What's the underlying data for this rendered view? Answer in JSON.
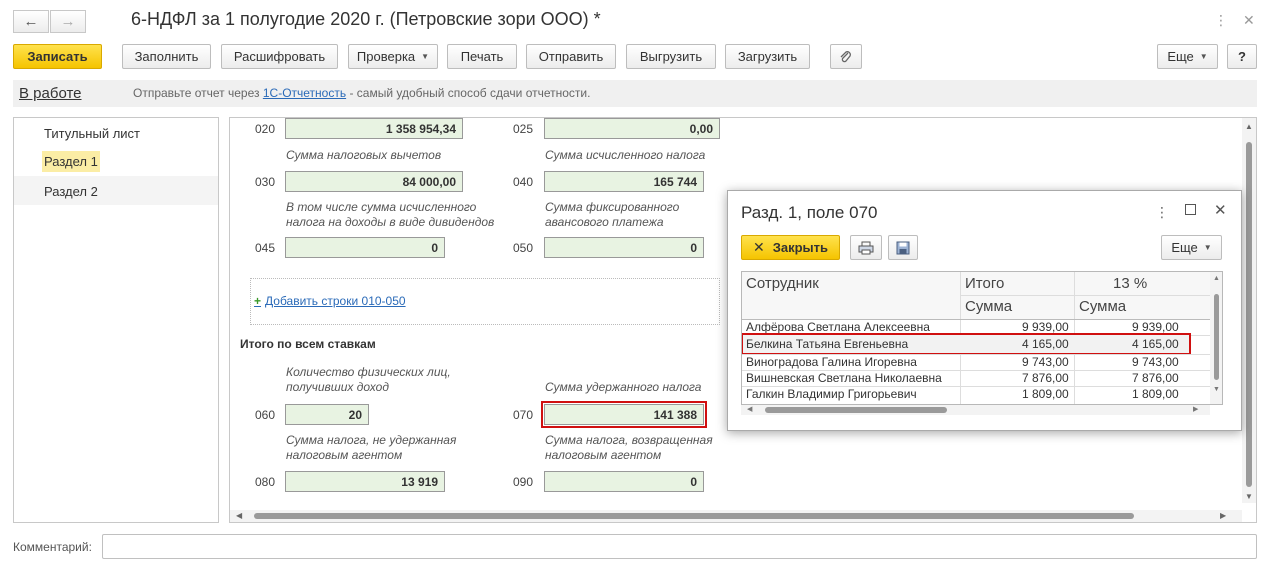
{
  "window": {
    "title": "6-НДФЛ за 1 полугодие 2020 г. (Петровские зори ООО) *",
    "back_icon": "arrow-left-icon",
    "forward_icon": "arrow-right-icon"
  },
  "toolbar": {
    "save": "Записать",
    "fill": "Заполнить",
    "decode": "Расшифровать",
    "check": "Проверка",
    "print": "Печать",
    "send": "Отправить",
    "export": "Выгрузить",
    "import": "Загрузить",
    "more": "Еще",
    "help": "?"
  },
  "status": {
    "state": "В работе",
    "hint_prefix": "Отправьте отчет через",
    "hint_link": "1С-Отчетность",
    "hint_suffix": "- самый удобный способ сдачи отчетности."
  },
  "sections": [
    {
      "label": "Титульный лист"
    },
    {
      "label": "Раздел 1"
    },
    {
      "label": "Раздел 2"
    }
  ],
  "form": {
    "f020": {
      "code": "020",
      "value": "1 358 954,34"
    },
    "f025": {
      "code": "025",
      "value": "0,00"
    },
    "f030": {
      "code": "030",
      "label": "Сумма налоговых вычетов",
      "value": "84 000,00"
    },
    "f040": {
      "code": "040",
      "label": "Сумма исчисленного налога",
      "value": "165 744"
    },
    "f045": {
      "code": "045",
      "label1": "В том числе сумма исчисленного",
      "label2": "налога на доходы в виде дивидендов",
      "value": "0"
    },
    "f050": {
      "code": "050",
      "label1": "Сумма фиксированного",
      "label2": "авансового платежа",
      "value": "0"
    },
    "add_rows": "Добавить строки 010-050",
    "totals_header": "Итого по всем ставкам",
    "f060": {
      "code": "060",
      "label1": "Количество физических лиц,",
      "label2": "получивших доход",
      "value": "20"
    },
    "f070": {
      "code": "070",
      "label": "Сумма удержанного налога",
      "value": "141 388"
    },
    "f080": {
      "code": "080",
      "label1": "Сумма налога, не удержанная",
      "label2": "налоговым агентом",
      "value": "13 919"
    },
    "f090": {
      "code": "090",
      "label1": "Сумма налога, возвращенная",
      "label2": "налоговым агентом",
      "value": "0"
    }
  },
  "popup": {
    "title": "Разд. 1, поле 070",
    "close_button": "Закрыть",
    "more": "Еще",
    "columns": {
      "employee": "Сотрудник",
      "total": "Итого",
      "rate": "13 %",
      "sum1": "Сумма",
      "sum2": "Сумма"
    },
    "rows": [
      {
        "name": "Алфёрова Светлана Алексеевна",
        "total": "9 939,00",
        "rate13": "9 939,00"
      },
      {
        "name": "Белкина Татьяна Евгеньевна",
        "total": "4 165,00",
        "rate13": "4 165,00"
      },
      {
        "name": "Виноградова Галина Игоревна",
        "total": "9 743,00",
        "rate13": "9 743,00"
      },
      {
        "name": "Вишневская Светлана Николаевна",
        "total": "7 876,00",
        "rate13": "7 876,00"
      },
      {
        "name": "Галкин Владимир Григорьевич",
        "total": "1 809,00",
        "rate13": "1 809,00"
      }
    ]
  },
  "comment": {
    "label": "Комментарий:",
    "value": ""
  },
  "colors": {
    "accent_yellow": "#f5c400",
    "field_bg": "#e8f3e2",
    "highlight_red": "#d01010",
    "link_blue": "#2a6ab8"
  }
}
